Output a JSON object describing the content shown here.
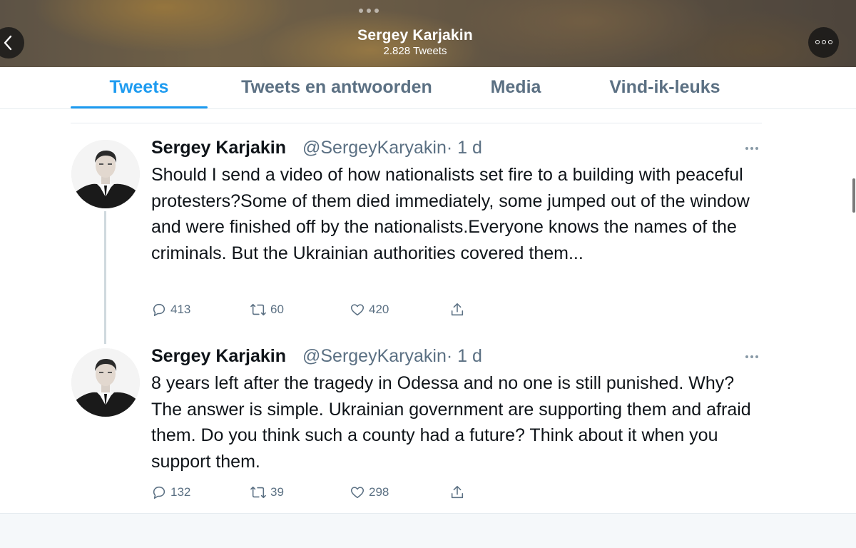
{
  "header": {
    "title": "Sergey Karjakin",
    "tweet_count": "2.828 Tweets",
    "back_icon": "chevron-left-icon",
    "more_icon": "more-horizontal-icon"
  },
  "tabs": [
    {
      "label": "Tweets",
      "active": true
    },
    {
      "label": "Tweets en antwoorden",
      "active": false
    },
    {
      "label": "Media",
      "active": false
    },
    {
      "label": "Vind-ik-leuks",
      "active": false
    }
  ],
  "colors": {
    "accent": "#1d9bf0",
    "secondary_text": "#5b7083"
  },
  "tweets": [
    {
      "name": "Sergey Karjakin",
      "handle": "@SergeyKaryakin",
      "time": "· 1 d",
      "text": "Should I send a video of how nationalists set fire to a building with peaceful protesters?Some of them died immediately, some jumped out of the window and were finished off by the nationalists.Everyone knows the names of the criminals. But the Ukrainian authorities covered them...",
      "replies": "413",
      "retweets": "60",
      "likes": "420"
    },
    {
      "name": "Sergey Karjakin",
      "handle": "@SergeyKaryakin",
      "time": "· 1 d",
      "text": "8 years left after the tragedy in Odessa and no one is still punished. Why? The answer is simple. Ukrainian government are supporting them and afraid them. Do you think such a county had a future? Think about it when you support them.",
      "replies": "132",
      "retweets": "39",
      "likes": "298"
    }
  ]
}
